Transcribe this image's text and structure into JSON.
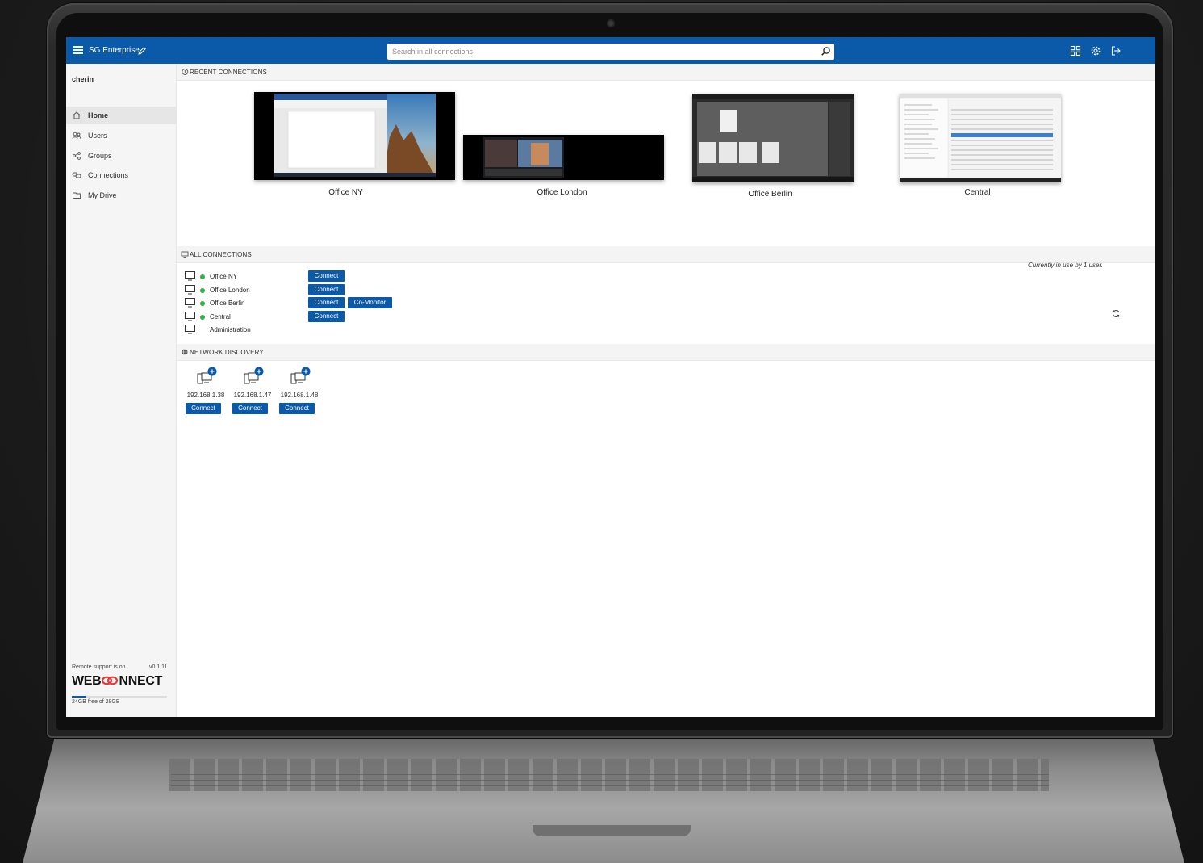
{
  "header": {
    "brand": "SG Enterprise",
    "search_placeholder": "Search in all connections"
  },
  "sidebar": {
    "user": "cherin",
    "items": [
      {
        "label": "Home",
        "icon": "home-icon",
        "active": true
      },
      {
        "label": "Users",
        "icon": "users-icon",
        "active": false
      },
      {
        "label": "Groups",
        "icon": "groups-icon",
        "active": false
      },
      {
        "label": "Connections",
        "icon": "connections-icon",
        "active": false
      },
      {
        "label": "My Drive",
        "icon": "folder-icon",
        "active": false
      }
    ],
    "support_text": "Remote support is on",
    "version": "v0.1.11",
    "logo_left": "WEB",
    "logo_right": "NNECT",
    "storage_text": "24GB free of 28GB",
    "storage_used_fraction": 0.14
  },
  "recent": {
    "title": "RECENT CONNECTIONS",
    "items": [
      {
        "label": "Office NY"
      },
      {
        "label": "Office London"
      },
      {
        "label": "Office Berlin"
      },
      {
        "label": "Central"
      }
    ]
  },
  "all": {
    "title": "ALL CONNECTIONS",
    "rows": [
      {
        "name": "Office NY",
        "online": true,
        "connect": "Connect"
      },
      {
        "name": "Office London",
        "online": true,
        "connect": "Connect"
      },
      {
        "name": "Office Berlin",
        "online": true,
        "connect": "Connect",
        "extra": "Co-Monitor"
      },
      {
        "name": "Central",
        "online": true,
        "connect": "Connect"
      },
      {
        "name": "Administration",
        "online": false
      }
    ],
    "in_use": "Currently in use by 1 user."
  },
  "discovery": {
    "title": "NETWORK DISCOVERY",
    "items": [
      {
        "ip": "192.168.1.38",
        "connect": "Connect"
      },
      {
        "ip": "192.168.1.47",
        "connect": "Connect"
      },
      {
        "ip": "192.168.1.48",
        "connect": "Connect"
      }
    ]
  },
  "colors": {
    "accent": "#0b59a9",
    "online": "#33b04a"
  }
}
